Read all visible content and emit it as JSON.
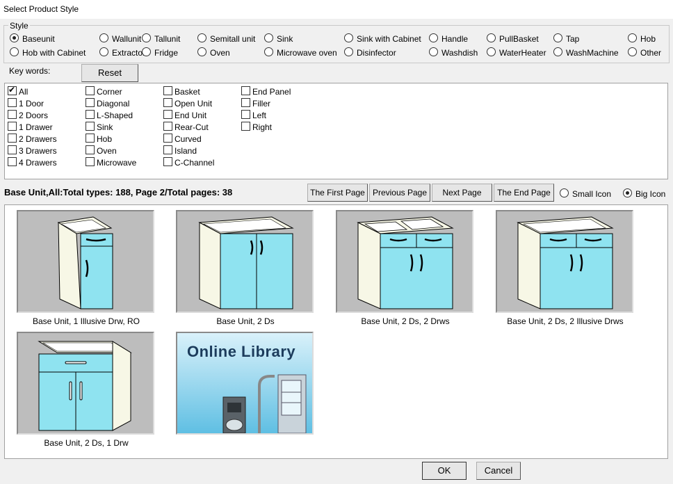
{
  "window": {
    "title": "Select Product Style"
  },
  "style": {
    "legend": "Style",
    "row1": [
      "Baseunit",
      "Wallunit",
      "Tallunit",
      "Semitall unit",
      "Sink",
      "Sink with Cabinet",
      "Handle",
      "PullBasket",
      "Tap",
      "Hob"
    ],
    "row2": [
      "Hob with Cabinet",
      "Extractor",
      "Fridge",
      "Oven",
      "Microwave oven",
      "Disinfector",
      "Washdish",
      "WaterHeater",
      "WashMachine",
      "Other"
    ],
    "selected": "Baseunit"
  },
  "keywords": {
    "label": "Key words:",
    "reset_label": "Reset",
    "col1": [
      "All",
      "1 Door",
      "2 Doors",
      "1 Drawer",
      "2 Drawers",
      "3 Drawers",
      "4 Drawers"
    ],
    "col2": [
      "Corner",
      "Diagonal",
      "L-Shaped",
      "Sink",
      "Hob",
      "Oven",
      "Microwave"
    ],
    "col3": [
      "Basket",
      "Open Unit",
      "End Unit",
      "Rear-Cut",
      "Curved",
      "Island",
      "C-Channel"
    ],
    "col4": [
      "End Panel",
      "Filler",
      "Left",
      "Right"
    ],
    "checked": "All"
  },
  "status": {
    "text": "Base Unit,All:Total types: 188, Page 2/Total pages: 38"
  },
  "nav": {
    "first": "The First Page",
    "previous": "Previous Page",
    "next": "Next Page",
    "end": "The End Page",
    "small_icon": "Small Icon",
    "big_icon": "Big Icon",
    "icon_mode": "Big Icon"
  },
  "products": [
    {
      "caption": "Base Unit, 1 Illusive Drw, RO",
      "icon": "cabinet-1-door-1-drawer"
    },
    {
      "caption": "Base Unit, 2 Ds",
      "icon": "cabinet-2-doors"
    },
    {
      "caption": "Base Unit, 2 Ds, 2 Drws",
      "icon": "cabinet-2-doors-2-drawers-open"
    },
    {
      "caption": "Base Unit, 2 Ds, 2 Illusive Drws",
      "icon": "cabinet-2-doors-2-drawers"
    },
    {
      "caption": "Base Unit, 2 Ds, 1 Drw",
      "icon": "cabinet-2-doors-1-drawer"
    },
    {
      "caption": "",
      "icon": "online-library-banner",
      "banner_text": "Online Library"
    }
  ],
  "footer": {
    "ok_label": "OK",
    "cancel_label": "Cancel"
  },
  "colors": {
    "cabinet_front": "#8fe3f0",
    "cabinet_side": "#f7f7e6",
    "card_bg": "#bdbdbd",
    "banner_bg": "#9ad9ee",
    "banner_text": "#1c3c5c"
  }
}
